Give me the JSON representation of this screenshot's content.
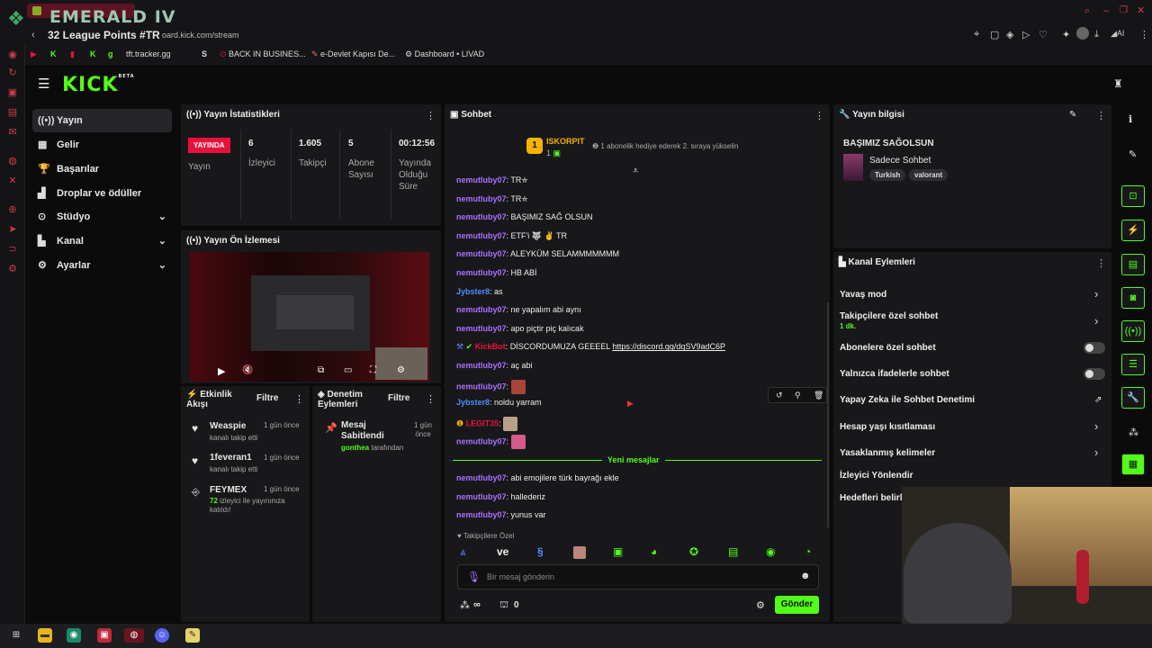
{
  "browser": {
    "overlay_title": "EMERALD IV",
    "overlay_sub": "32 League Points #TR",
    "url": "oard.kick.com/stream",
    "bookmarks": [
      "g",
      "tft.tracker.gg",
      "S",
      "BACK IN BUSINES...",
      "e-Devlet Kapısı De...",
      "Dashboard • LIVAD"
    ],
    "toolbar_ai": "AI"
  },
  "kick": {
    "logo": "KICK",
    "beta": "BETA"
  },
  "sidebar": {
    "items": [
      {
        "label": "Yayın",
        "icon": "stream-icon"
      },
      {
        "label": "Gelir",
        "icon": "revenue-icon"
      },
      {
        "label": "Başarılar",
        "icon": "trophy-icon"
      },
      {
        "label": "Droplar ve ödüller",
        "icon": "gift-icon"
      },
      {
        "label": "Stüdyo",
        "icon": "studio-icon"
      },
      {
        "label": "Kanal",
        "icon": "channel-icon"
      },
      {
        "label": "Ayarlar",
        "icon": "settings-icon"
      }
    ]
  },
  "stats": {
    "title": "Yayın İstatistikleri",
    "live": "YAYINDA",
    "live_label": "Yayın",
    "viewers": "6",
    "viewers_label": "İzleyici",
    "followers": "1.605",
    "followers_label": "Takipçi",
    "subs": "5",
    "subs_label": "Abone Sayısı",
    "uptime": "00:12:56",
    "uptime_label": "Yayında Olduğu Süre"
  },
  "preview": {
    "title": "Yayın Ön İzlemesi"
  },
  "activity": {
    "title": "Etkinlik Akışı",
    "filter": "Filtre",
    "items": [
      {
        "name": "Weaspie",
        "time": "1 gün önce",
        "desc": "kanalı takip etti"
      },
      {
        "name": "1feveran1",
        "time": "1 gün önce",
        "desc": "kanalı takip etti"
      },
      {
        "name": "FEYMEX",
        "time": "1 gün önce",
        "count": "72",
        "desc": "izleyici ile yayınınıza katıldı!"
      }
    ]
  },
  "moderation": {
    "title": "Denetim Eylemleri",
    "filter": "Filtre",
    "item": {
      "title": "Mesaj Sabitlendi",
      "time": "1 gün önce",
      "by": "gonthea",
      "by_suffix": "tarafından"
    }
  },
  "chat": {
    "title": "Sohbet",
    "gifter": {
      "rank": "1",
      "name": "ISKORPIT",
      "count": "1",
      "note": "1 abonelik hediye ederek 2. sıraya yükselin"
    },
    "messages": [
      {
        "user": "nemutluby07",
        "text": "TR⛤"
      },
      {
        "user": "nemutluby07",
        "text": "TR⛤"
      },
      {
        "user": "nemutluby07",
        "text": "BAŞIMIZ SAĞ OLSUN"
      },
      {
        "user": "nemutluby07",
        "text": "ETF'i 🐺 ✌ TR"
      },
      {
        "user": "nemutluby07",
        "text": "ALEYKÜM SELAMMMMMMM"
      },
      {
        "user": "nemutluby07",
        "text": "HB ABİ"
      },
      {
        "user": "Jybster8",
        "text": "as"
      },
      {
        "user": "nemutluby07",
        "text": "ne yapalım abi aynı"
      },
      {
        "user": "nemutluby07",
        "text": "apo piçtir piç kalıcak"
      },
      {
        "user": "KickBot",
        "text": "DİSCORDUMUZA GEEEEL",
        "link": "https://discord.gg/dqSV9adC6P"
      },
      {
        "user": "nemutluby07",
        "text": "aç abi"
      },
      {
        "user": "nemutluby07",
        "text": ""
      },
      {
        "user": "Jybster8",
        "text": "noldu yarram"
      },
      {
        "user": "LEGIT35",
        "text": ""
      },
      {
        "user": "nemutluby07",
        "text": ""
      }
    ],
    "new_messages": "Yeni mesajlar",
    "new": [
      {
        "user": "nemutluby07",
        "text": "abi emojilere türk bayrağı ekle"
      },
      {
        "user": "nemutluby07",
        "text": "hallederiz"
      },
      {
        "user": "nemutluby07",
        "text": "yunus var"
      }
    ],
    "followers_only": "Takipçilere Özel",
    "emote_ve": "ve",
    "input_placeholder": "Bir mesaj gönderin",
    "infinity": "∞",
    "points": "0",
    "send": "Gönder"
  },
  "stream_info": {
    "title": "Yayın bilgisi",
    "stream_title": "BAŞIMIZ SAĞOLSUN",
    "category": "Sadece Sohbet",
    "tags": [
      "Turkish",
      "valorant"
    ]
  },
  "channel_actions": {
    "title": "Kanal Eylemleri",
    "slow": "Yavaş mod",
    "followers": "Takipçilere özel sohbet",
    "followers_sub": "1 dk.",
    "subs": "Abonelere özel sohbet",
    "emotes": "Yalnızca ifadelerle sohbet",
    "ai": "Yapay Zeka ile Sohbet Denetimi",
    "age": "Hesap yaşı kısıtlaması",
    "banned": "Yasaklanmış kelimeler",
    "redirect": "İzleyici Yönlendir",
    "goals": "Hedefleri belirle"
  },
  "colors": {
    "accent": "#53fc18",
    "live": "#e9113c",
    "panel": "#18181b"
  }
}
